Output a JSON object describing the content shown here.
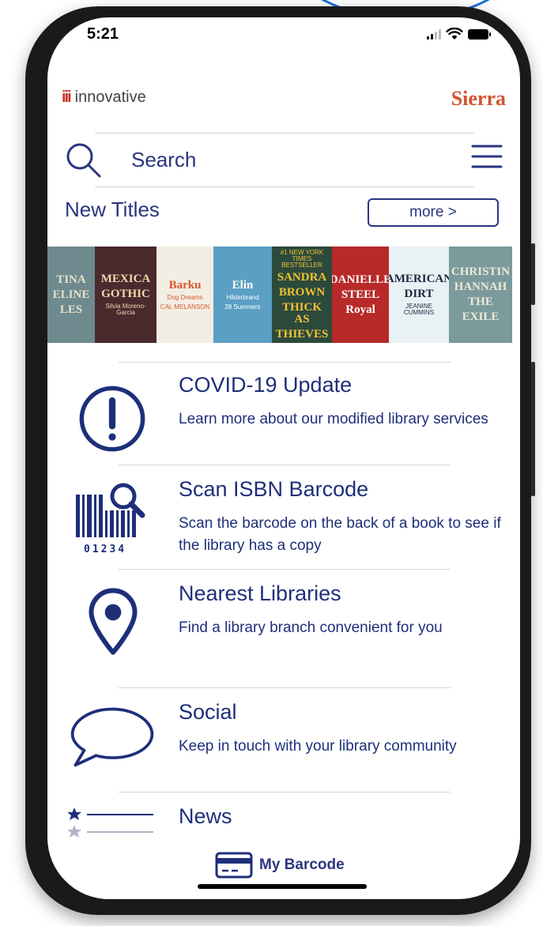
{
  "status_bar": {
    "time": "5:21"
  },
  "header": {
    "logo_text": "innovative",
    "logo_mark": "iii",
    "brand": "Sierra"
  },
  "search": {
    "label": "Search"
  },
  "new_titles": {
    "heading": "New Titles",
    "more_label": "more >",
    "covers": [
      {
        "lines": [
          "TINA",
          "ELINE",
          "LES"
        ],
        "bg": "#6e8a8e",
        "fg": "#e8e0c8"
      },
      {
        "lines": [
          "MEXICA",
          "GOTHIC",
          "Silvia Moreno-Garcia"
        ],
        "bg": "#4a2a2c",
        "fg": "#f0d8b0"
      },
      {
        "lines": [
          "Barku",
          "Dog Dreams",
          "CAL MELANSON"
        ],
        "bg": "#f3eee4",
        "fg": "#d9572a"
      },
      {
        "lines": [
          "Elin",
          "Hilderbrand",
          "28 Summers"
        ],
        "bg": "#5b9fc4",
        "fg": "#ffffff"
      },
      {
        "lines": [
          "#1 NEW YORK TIMES BESTSELLER",
          "SANDRA",
          "BROWN",
          "THICK AS",
          "THIEVES"
        ],
        "bg": "#2c4a3c",
        "fg": "#f2c233"
      },
      {
        "lines": [
          "DANIELLE",
          "STEEL",
          "Royal"
        ],
        "bg": "#b82a2a",
        "fg": "#ffffff"
      },
      {
        "lines": [
          "AMERICAN",
          "DIRT",
          "JEANINE CUMMINS"
        ],
        "bg": "#e9f1f5",
        "fg": "#1b2a40"
      },
      {
        "lines": [
          "CHRISTIN",
          "HANNAH",
          "THE",
          "EXILE"
        ],
        "bg": "#7a9a9c",
        "fg": "#f0ead8"
      }
    ]
  },
  "menu": [
    {
      "icon": "alert-circle-icon",
      "title": "COVID-19 Update",
      "description": "Learn more about our modified library services"
    },
    {
      "icon": "barcode-scan-icon",
      "title": "Scan ISBN Barcode",
      "description": "Scan the barcode on the back of a book to see if the library has a copy",
      "barcode_digits": "01234"
    },
    {
      "icon": "location-pin-icon",
      "title": "Nearest Libraries",
      "description": "Find a library branch convenient for you"
    },
    {
      "icon": "speech-bubble-icon",
      "title": "Social",
      "description": "Keep in touch with your library community"
    },
    {
      "icon": "news-list-icon",
      "title": "News",
      "description": ""
    }
  ],
  "bottom_bar": {
    "label": "My Barcode",
    "icon": "card-icon"
  },
  "colors": {
    "brand_navy": "#2a3580",
    "sierra_orange": "#d2542f",
    "logo_red": "#c8362a"
  }
}
